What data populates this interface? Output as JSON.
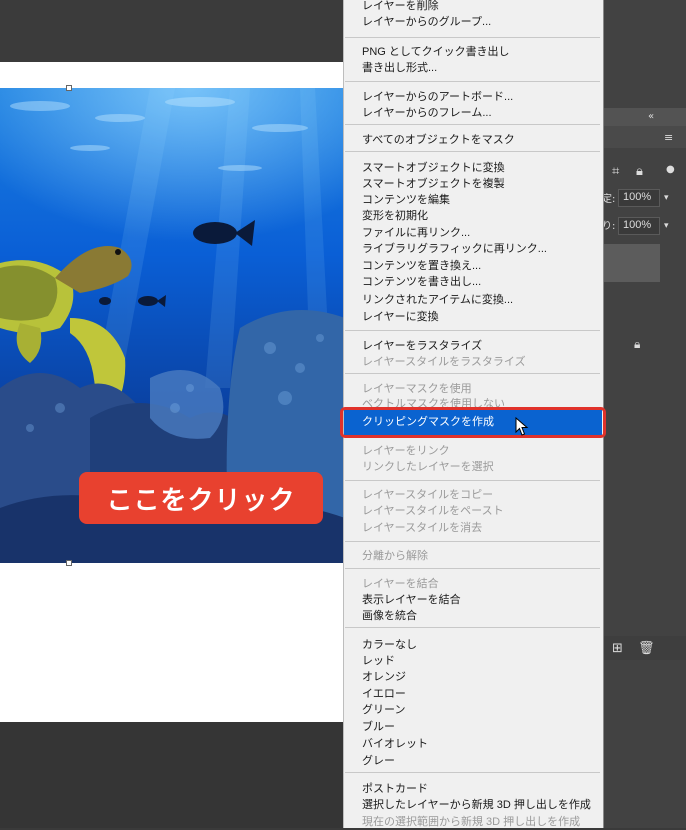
{
  "callout": {
    "text": "ここをクリック"
  },
  "layers_panel": {
    "opacity_value": "100%",
    "fill_value": "100%",
    "fill_suffix": "り:",
    "opacity_suffix": "定:"
  },
  "context_menu": {
    "items": [
      {
        "label": "レイヤーを削除",
        "enabled": true
      },
      {
        "label": "レイヤーからのグループ...",
        "enabled": true
      },
      {
        "label": "PNG としてクイック書き出し",
        "enabled": true
      },
      {
        "label": "書き出し形式...",
        "enabled": true
      },
      {
        "label": "レイヤーからのアートボード...",
        "enabled": true
      },
      {
        "label": "レイヤーからのフレーム...",
        "enabled": true
      },
      {
        "label": "すべてのオブジェクトをマスク",
        "enabled": true
      },
      {
        "label": "スマートオブジェクトに変換",
        "enabled": true
      },
      {
        "label": "スマートオブジェクトを複製",
        "enabled": true
      },
      {
        "label": "コンテンツを編集",
        "enabled": true
      },
      {
        "label": "変形を初期化",
        "enabled": true
      },
      {
        "label": "ファイルに再リンク...",
        "enabled": true
      },
      {
        "label": "ライブラリグラフィックに再リンク...",
        "enabled": true
      },
      {
        "label": "コンテンツを置き換え...",
        "enabled": true
      },
      {
        "label": "コンテンツを書き出し...",
        "enabled": true
      },
      {
        "label": "リンクされたアイテムに変換...",
        "enabled": true
      },
      {
        "label": "レイヤーに変換",
        "enabled": true
      },
      {
        "label": "レイヤーをラスタライズ",
        "enabled": true
      },
      {
        "label": "レイヤースタイルをラスタライズ",
        "enabled": false
      },
      {
        "label": "レイヤーマスクを使用",
        "enabled": false
      },
      {
        "label": "ベクトルマスクを使用しない",
        "enabled": false
      },
      {
        "label": "クリッピングマスクを作成",
        "enabled": true,
        "highlighted": true
      },
      {
        "label": "レイヤーをリンク",
        "enabled": false
      },
      {
        "label": "リンクしたレイヤーを選択",
        "enabled": false
      },
      {
        "label": "レイヤースタイルをコピー",
        "enabled": false
      },
      {
        "label": "レイヤースタイルをペースト",
        "enabled": false
      },
      {
        "label": "レイヤースタイルを消去",
        "enabled": false
      },
      {
        "label": "分離から解除",
        "enabled": false
      },
      {
        "label": "レイヤーを結合",
        "enabled": false
      },
      {
        "label": "表示レイヤーを結合",
        "enabled": true
      },
      {
        "label": "画像を統合",
        "enabled": true
      },
      {
        "label": "カラーなし",
        "enabled": true
      },
      {
        "label": "レッド",
        "enabled": true
      },
      {
        "label": "オレンジ",
        "enabled": true
      },
      {
        "label": "イエロー",
        "enabled": true
      },
      {
        "label": "グリーン",
        "enabled": true
      },
      {
        "label": "ブルー",
        "enabled": true
      },
      {
        "label": "バイオレット",
        "enabled": true
      },
      {
        "label": "グレー",
        "enabled": true
      },
      {
        "label": "ポストカード",
        "enabled": true
      },
      {
        "label": "選択したレイヤーから新規 3D 押し出しを作成",
        "enabled": true
      },
      {
        "label": "現在の選択範囲から新規 3D 押し出しを作成",
        "enabled": false
      }
    ]
  },
  "colors": {
    "highlight": "#0a63d0",
    "callout": "#e8412f",
    "annotation_outline": "#e0322b"
  }
}
